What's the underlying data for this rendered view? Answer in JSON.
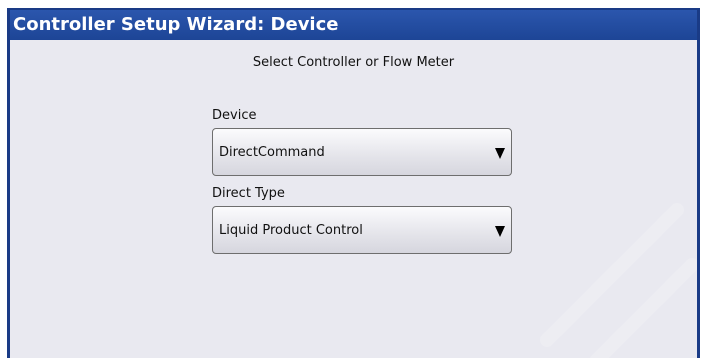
{
  "window": {
    "title": "Controller Setup Wizard:  Device",
    "subtitle": "Select Controller or Flow Meter"
  },
  "device": {
    "label": "Device",
    "value": "DirectCommand"
  },
  "direct_type": {
    "label": "Direct Type",
    "value": "Liquid Product Control"
  },
  "colors": {
    "titlebar": "#2250a5",
    "background": "#e9e9f0",
    "border": "#1a3b86"
  },
  "icons": {
    "dropdown_arrow": "triangle-down"
  }
}
